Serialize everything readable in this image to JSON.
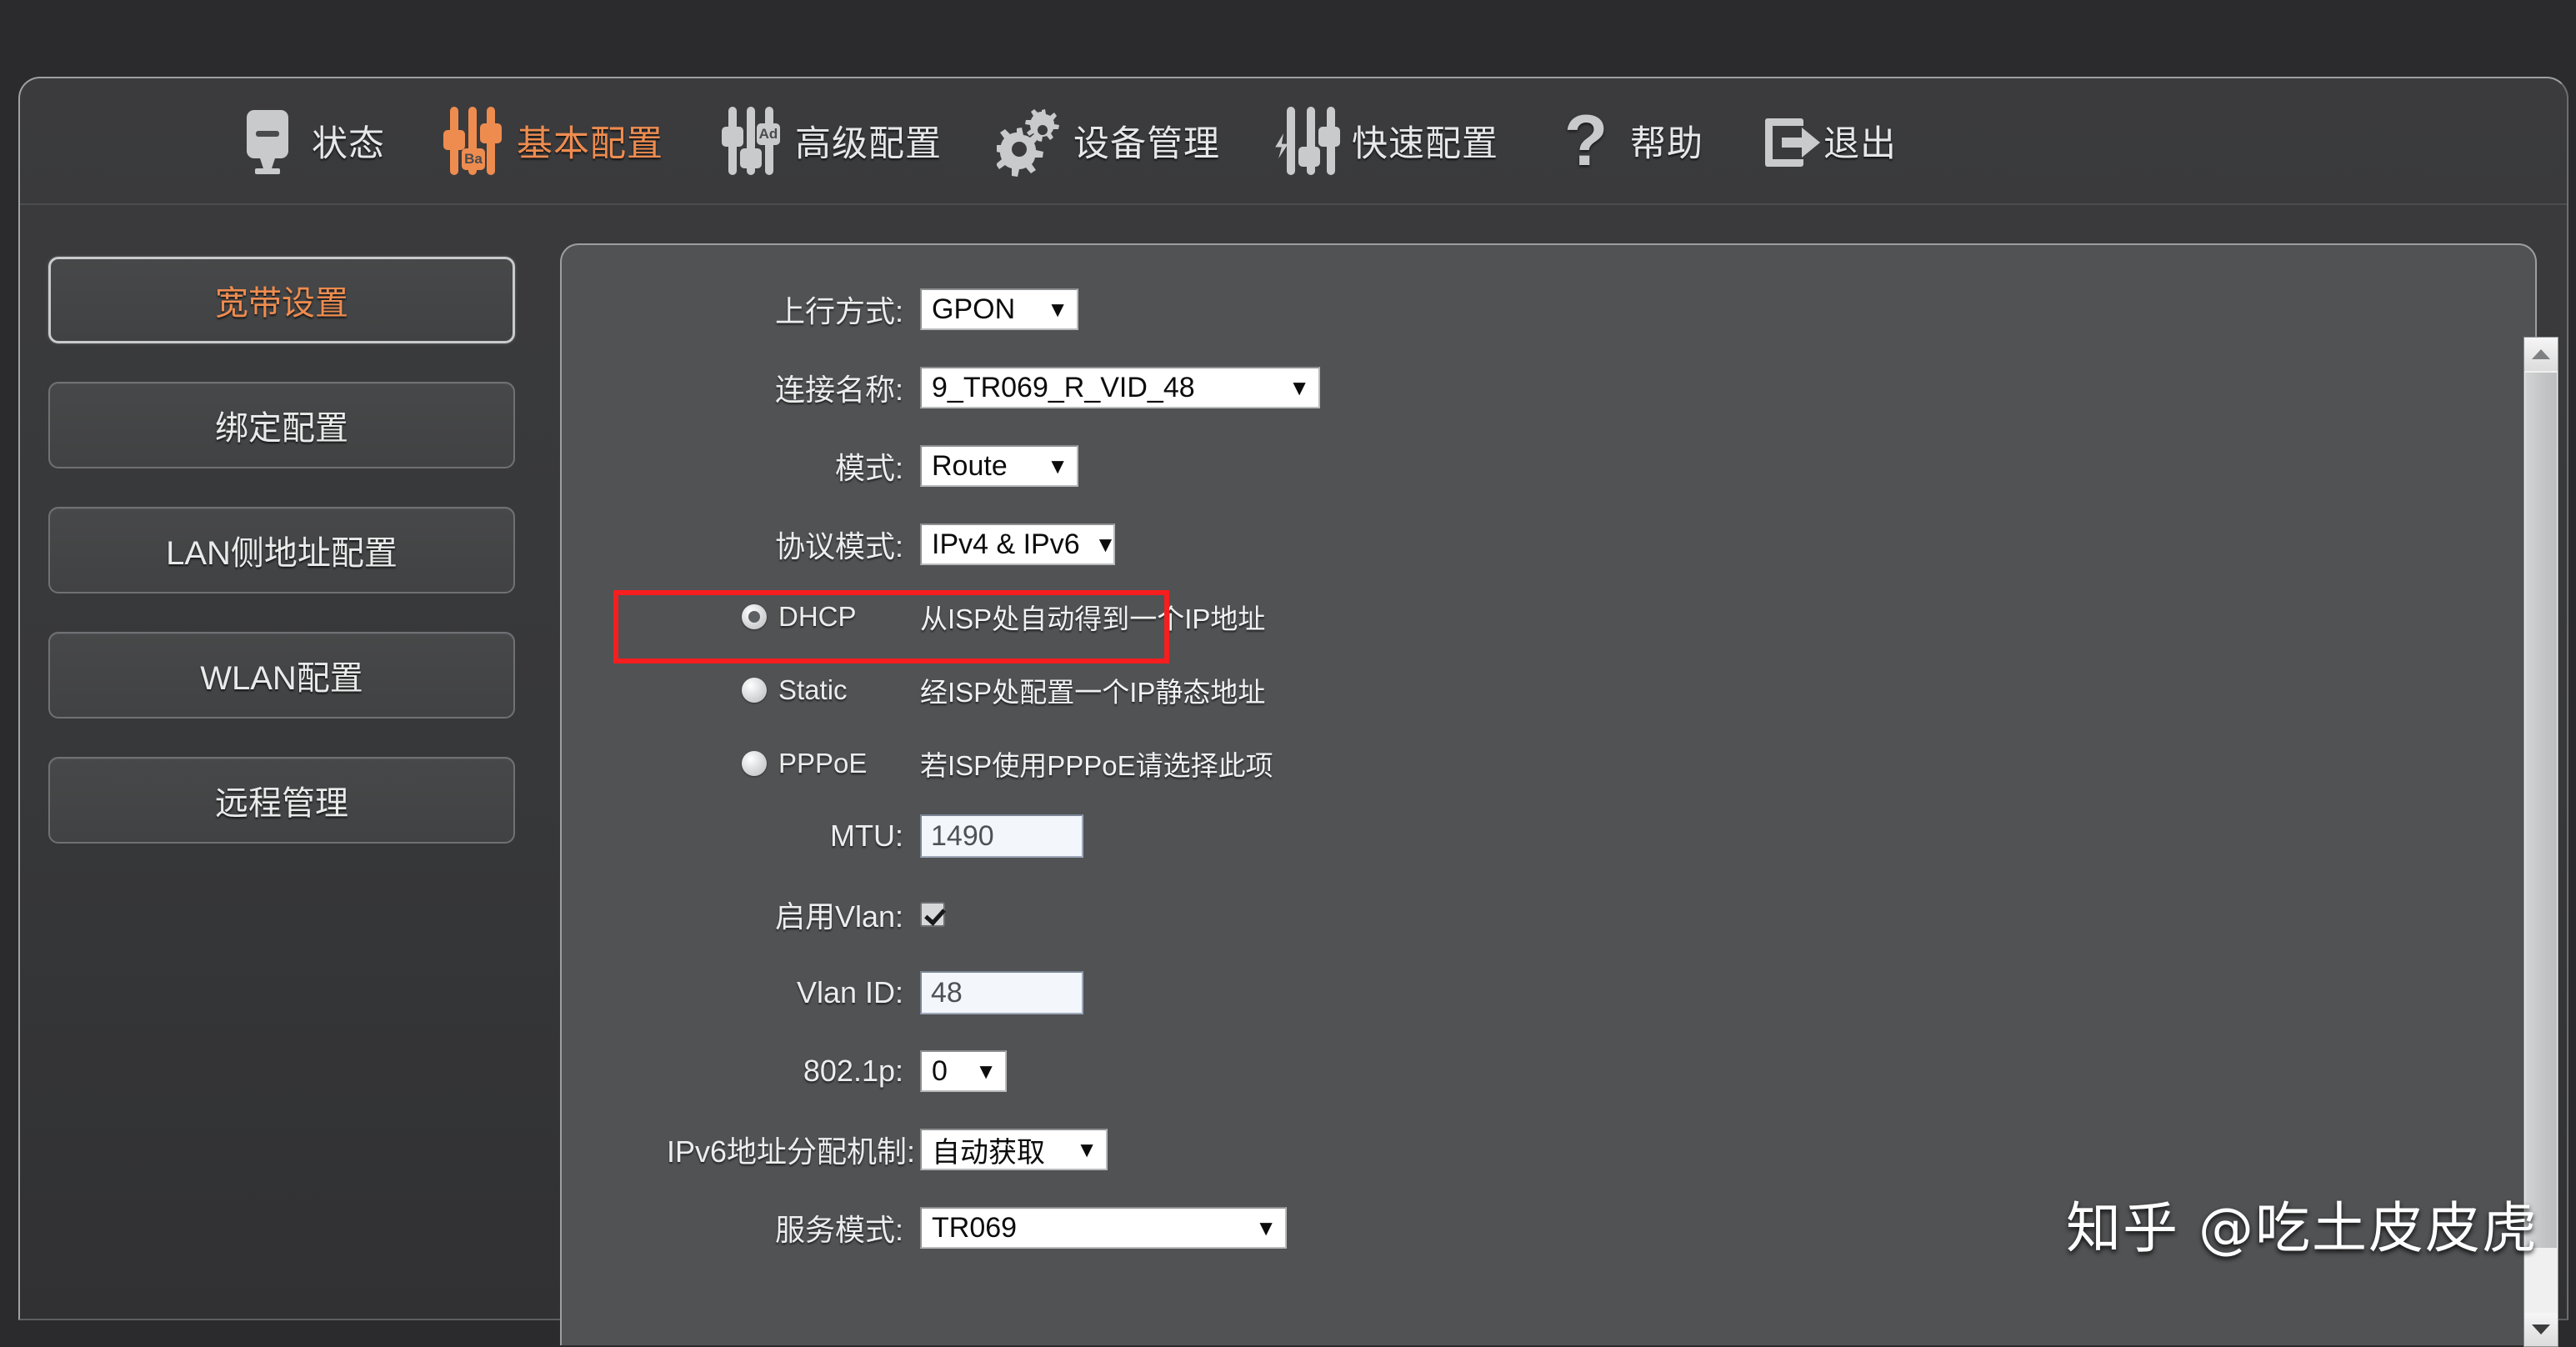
{
  "theme": {
    "accent": "#ee8c50",
    "panel_bg": "#515254",
    "frame_bg": "#3b3b3d",
    "page_bg": "#2b2b2d",
    "text": "#eceded",
    "highlight_border": "#f61e1e"
  },
  "topnav": {
    "items": [
      {
        "label": "状态",
        "icon": "monitor-icon",
        "active": false
      },
      {
        "label": "基本配置",
        "icon": "sliders-basic-icon",
        "active": true
      },
      {
        "label": "高级配置",
        "icon": "sliders-advanced-icon",
        "active": false
      },
      {
        "label": "设备管理",
        "icon": "gears-icon",
        "active": false
      },
      {
        "label": "快速配置",
        "icon": "sliders-quick-icon",
        "active": false
      },
      {
        "label": "帮助",
        "icon": "question-mark-icon",
        "active": false
      },
      {
        "label": "退出",
        "icon": "exit-arrow-icon",
        "active": false
      }
    ],
    "icon_tags": {
      "basic": "Ba",
      "advanced": "Ad"
    }
  },
  "sidebar": {
    "items": [
      {
        "label": "宽带设置",
        "active": true
      },
      {
        "label": "绑定配置",
        "active": false
      },
      {
        "label": "LAN侧地址配置",
        "active": false
      },
      {
        "label": "WLAN配置",
        "active": false
      },
      {
        "label": "远程管理",
        "active": false
      }
    ]
  },
  "form": {
    "uplink_mode": {
      "label": "上行方式:",
      "value": "GPON"
    },
    "conn_name": {
      "label": "连接名称:",
      "value": "9_TR069_R_VID_48"
    },
    "mode": {
      "label": "模式:",
      "value": "Route"
    },
    "protocol_mode": {
      "label": "协议模式:",
      "value": "IPv4 & IPv6",
      "highlighted": true
    },
    "wan_types": [
      {
        "label": "DHCP",
        "desc": "从ISP处自动得到一个IP地址",
        "selected": true
      },
      {
        "label": "Static",
        "desc": "经ISP处配置一个IP静态地址",
        "selected": false
      },
      {
        "label": "PPPoE",
        "desc": "若ISP使用PPPoE请选择此项",
        "selected": false
      }
    ],
    "mtu": {
      "label": "MTU:",
      "value": "1490"
    },
    "enable_vlan": {
      "label": "启用Vlan:",
      "checked": true
    },
    "vlan_id": {
      "label": "Vlan ID:",
      "value": "48"
    },
    "dot1p": {
      "label": "802.1p:",
      "value": "0"
    },
    "ipv6_alloc": {
      "label": "IPv6地址分配机制:",
      "value": "自动获取"
    },
    "service_mode": {
      "label": "服务模式:",
      "value": "TR069"
    }
  },
  "scrollbar": {
    "up_arrow": "▲",
    "down_arrow": "▼"
  },
  "watermark": {
    "text": "知乎 @吃土皮皮虎"
  },
  "glyphs": {
    "caret_down": "▼"
  }
}
